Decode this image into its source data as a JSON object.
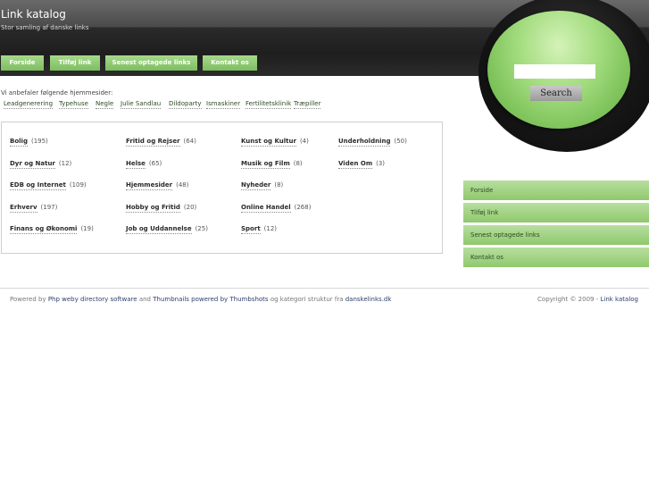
{
  "header": {
    "title": "Link katalog",
    "subtitle": "Stor samling af danske links"
  },
  "nav": [
    {
      "label": "Forside"
    },
    {
      "label": "Tilføj link"
    },
    {
      "label": "Senest optagede links"
    },
    {
      "label": "Kontakt os"
    }
  ],
  "search": {
    "input_value": "",
    "button_label": "Search"
  },
  "recommend": {
    "label": "Vi anbefaler følgende hjemmesider:",
    "links": [
      {
        "label": "Leadgenerering"
      },
      {
        "label": "Typehuse"
      },
      {
        "label": "Negle"
      },
      {
        "label": "Julie Sandlau"
      },
      {
        "label": "Dildoparty"
      },
      {
        "label": "Ismaskiner"
      },
      {
        "label": "Fertilitetsklinik"
      },
      {
        "label": "Træpiller"
      }
    ]
  },
  "categories": [
    {
      "name": "Bolig",
      "count": "(195)"
    },
    {
      "name": "Dyr og Natur",
      "count": "(12)"
    },
    {
      "name": "EDB og Internet",
      "count": "(109)"
    },
    {
      "name": "Erhverv",
      "count": "(197)"
    },
    {
      "name": "Finans og Økonomi",
      "count": "(19)"
    },
    {
      "name": "Fritid og Rejser",
      "count": "(64)"
    },
    {
      "name": "Helse",
      "count": "(65)"
    },
    {
      "name": "Hjemmesider",
      "count": "(48)"
    },
    {
      "name": "Hobby og Fritid",
      "count": "(20)"
    },
    {
      "name": "Job og Uddannelse",
      "count": "(25)"
    },
    {
      "name": "Kunst og Kultur",
      "count": "(4)"
    },
    {
      "name": "Musik og Film",
      "count": "(8)"
    },
    {
      "name": "Nyheder",
      "count": "(8)"
    },
    {
      "name": "Online Handel",
      "count": "(268)"
    },
    {
      "name": "Sport",
      "count": "(12)"
    },
    {
      "name": "Underholdning",
      "count": "(50)"
    },
    {
      "name": "Viden Om",
      "count": "(3)"
    }
  ],
  "sidebar": {
    "items": [
      {
        "label": "Forside"
      },
      {
        "label": "Tilføj link"
      },
      {
        "label": "Senest optagede links"
      },
      {
        "label": "Kontakt os"
      }
    ]
  },
  "footer": {
    "powered_by": "Powered by",
    "php_link": "Php weby directory software",
    "and": "and",
    "thumbs_link": "Thumbnails powered by Thumbshots",
    "category_text": "og kategori struktur fra",
    "danske_link": "danskelinks.dk",
    "copyright": "Copyright © 2009 -",
    "copyright_link": "Link katalog"
  },
  "colors": {
    "accent_green": "#8fc86d",
    "header_dark": "#2a2a2a"
  }
}
